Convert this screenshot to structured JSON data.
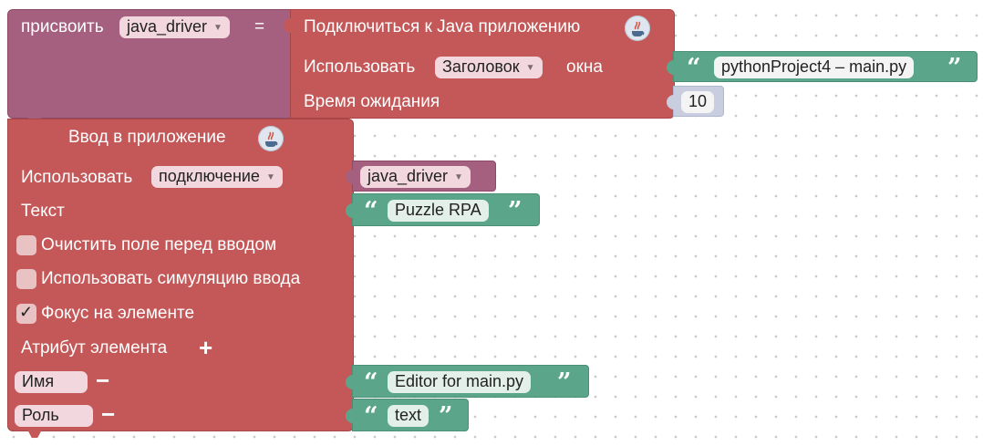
{
  "assign_block": {
    "label": "присвоить",
    "variable": "java_driver",
    "equals": "="
  },
  "connect_block": {
    "title": "Подключиться к Java приложению",
    "icon": "java-icon",
    "use_label": "Использовать",
    "use_dropdown": "Заголовок",
    "window_label": "окна",
    "window_value": "pythonProject4 – main.py",
    "timeout_label": "Время ожидания",
    "timeout_value": "10"
  },
  "input_block": {
    "title": "Ввод в приложение",
    "icon": "java-icon",
    "use_label": "Использовать",
    "use_dropdown": "подключение",
    "connection_value": "java_driver",
    "text_label": "Текст",
    "text_value": "Puzzle RPA",
    "clear_label": "Очистить поле перед вводом",
    "clear_checked": false,
    "simulate_label": "Использовать симуляцию ввода",
    "simulate_checked": false,
    "focus_label": "Фокус на элементе",
    "focus_checked": true,
    "focus_mark": "✓",
    "attribute_label": "Атрибут элемента",
    "plus": "+",
    "minus": "−",
    "attributes": [
      {
        "name": "Имя",
        "value": "Editor for main.py"
      },
      {
        "name": "Роль",
        "value": "text"
      }
    ]
  },
  "colors": {
    "variable_block": "#a5607f",
    "action_block": "#c45858",
    "text_block": "#5ba68b",
    "number_block": "#c8cde0"
  }
}
